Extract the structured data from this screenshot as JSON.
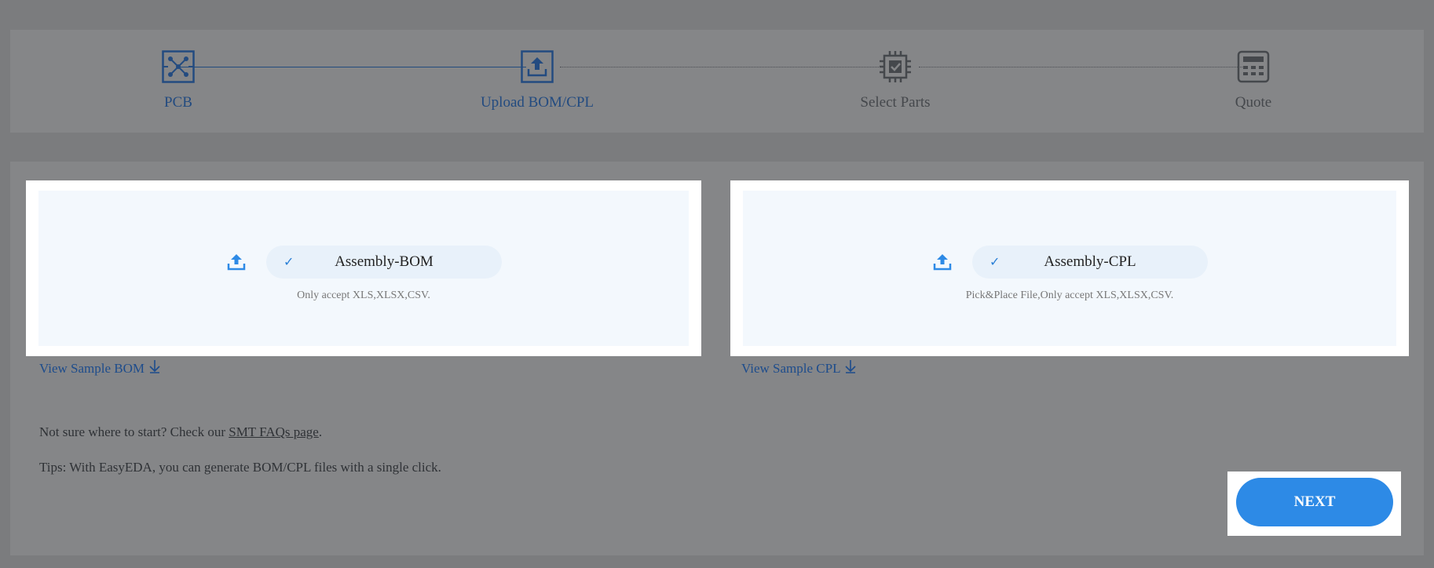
{
  "stepper": {
    "steps": [
      {
        "label": "PCB",
        "icon": "pcb-schematic-icon",
        "state": "completed"
      },
      {
        "label": "Upload BOM/CPL",
        "icon": "upload-icon",
        "state": "active"
      },
      {
        "label": "Select Parts",
        "icon": "chip-check-icon",
        "state": "inactive"
      },
      {
        "label": "Quote",
        "icon": "calculator-icon",
        "state": "inactive"
      }
    ]
  },
  "bom": {
    "file_name": "Assembly-BOM",
    "accept_text": "Only accept XLS,XLSX,CSV.",
    "sample_link": "View Sample BOM",
    "upload_icon": "upload-icon",
    "check_icon": "check-icon"
  },
  "cpl": {
    "file_name": "Assembly-CPL",
    "accept_text": "Pick&Place File,Only accept XLS,XLSX,CSV.",
    "sample_link": "View Sample CPL",
    "upload_icon": "upload-icon",
    "check_icon": "check-icon"
  },
  "help": {
    "faq_prefix": "Not sure where to start? Check our ",
    "faq_link": "SMT FAQs page",
    "faq_suffix": ".",
    "tips": "Tips: With EasyEDA, you can generate BOM/CPL files with a single click."
  },
  "actions": {
    "next_label": "NEXT"
  },
  "colors": {
    "accent": "#2d8ae6",
    "active_step": "#234b80",
    "link": "#1d4c8c",
    "overlay": "#7b7c7e"
  }
}
